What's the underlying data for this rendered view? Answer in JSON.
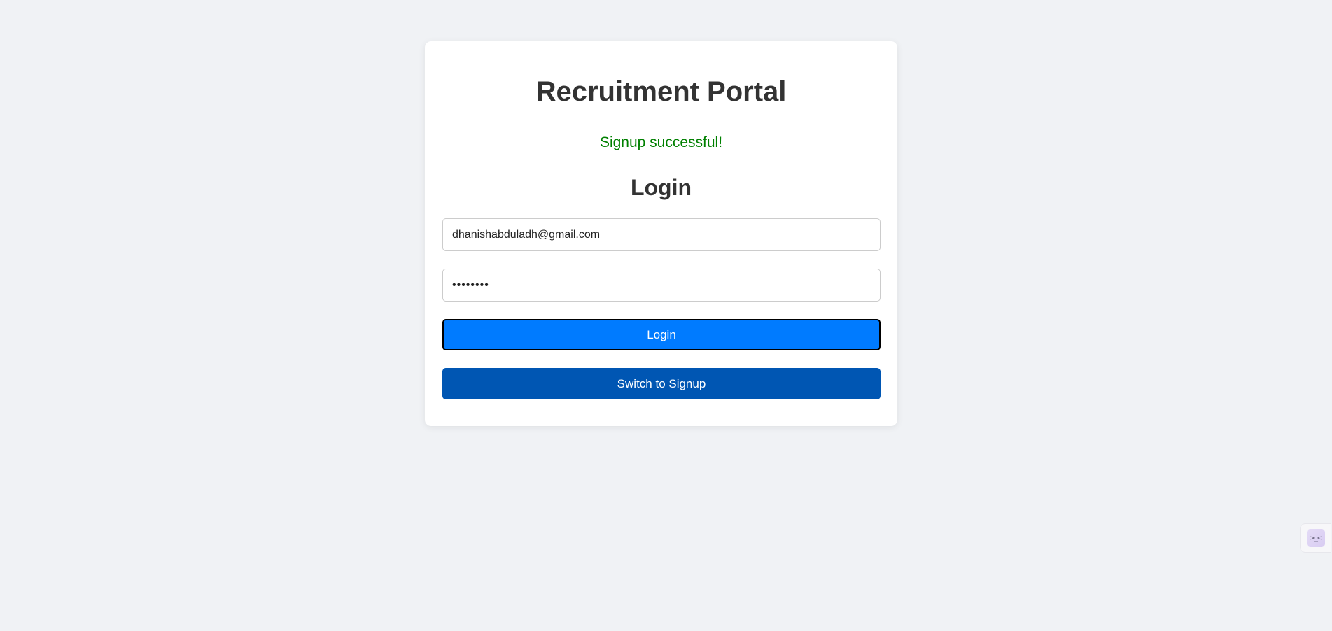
{
  "app": {
    "title": "Recruitment Portal",
    "status_message": "Signup successful!",
    "status_color": "#008000",
    "form_heading": "Login"
  },
  "form": {
    "email_value": "dhanishabduladh@gmail.com",
    "password_value": "••••••••"
  },
  "buttons": {
    "login_label": "Login",
    "switch_label": "Switch to Signup"
  },
  "colors": {
    "background": "#f0f2f5",
    "card": "#ffffff",
    "primary": "#007bff",
    "secondary": "#0056b3",
    "text": "#333333"
  },
  "side_widget": {
    "icon": "face-icon",
    "glyph": ">_<"
  }
}
